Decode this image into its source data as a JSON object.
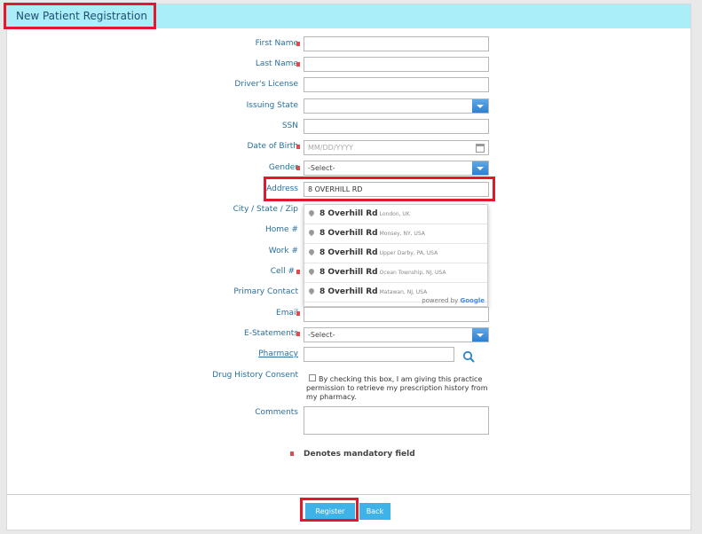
{
  "header": {
    "title": "New Patient Registration"
  },
  "form": {
    "first_name_label": "First Name",
    "last_name_label": "Last Name",
    "drivers_license_label": "Driver's License",
    "issuing_state_label": "Issuing State",
    "ssn_label": "SSN",
    "dob_label": "Date of Birth",
    "dob_placeholder": "MM/DD/YYYY",
    "gender_label": "Gender",
    "gender_value": "-Select-",
    "address_label": "Address",
    "address_value": "8 OVERHILL RD",
    "city_state_zip_label": "City / State / Zip",
    "home_label": "Home #",
    "work_label": "Work #",
    "cell_label": "Cell #",
    "primary_contact_label": "Primary Contact",
    "email_label": "Email",
    "estatements_label": "E-Statements",
    "estatements_value": "-Select-",
    "pharmacy_label": "Pharmacy",
    "drug_history_label": "Drug History Consent",
    "drug_history_text": "By checking this box, I am giving this practice permission to retrieve my prescription history from my pharmacy.",
    "comments_label": "Comments",
    "mandatory_legend": "Denotes mandatory field"
  },
  "suggestions": [
    {
      "main": "8 Overhill Rd",
      "secondary": "London, UK"
    },
    {
      "main": "8 Overhill Rd",
      "secondary": "Monsey, NY, USA"
    },
    {
      "main": "8 Overhill Rd",
      "secondary": "Upper Darby, PA, USA"
    },
    {
      "main": "8 Overhill Rd",
      "secondary": "Ocean Township, NJ, USA"
    },
    {
      "main": "8 Overhill Rd",
      "secondary": "Matawan, NJ, USA"
    }
  ],
  "powered_by": {
    "text": "powered by",
    "brand": "Google"
  },
  "buttons": {
    "register": "Register",
    "back": "Back"
  },
  "colors": {
    "header_bg": "#aaeefa",
    "required_marker": "#e14b4b",
    "button_bg": "#3fb2e8",
    "highlight": "#e2192c"
  }
}
